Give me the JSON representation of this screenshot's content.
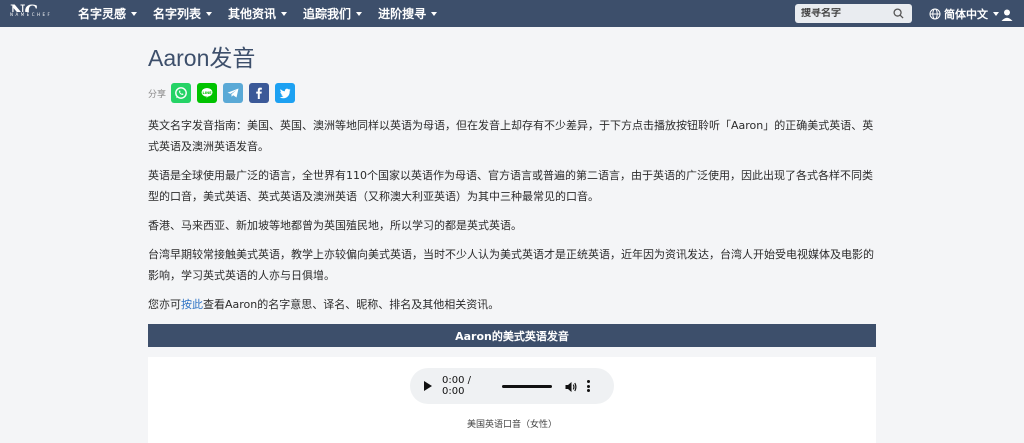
{
  "brand": {
    "logo_text": "NC",
    "logo_sub": "NAMECHEF"
  },
  "nav": {
    "items": [
      {
        "label": "名字灵感"
      },
      {
        "label": "名字列表"
      },
      {
        "label": "其他资讯"
      },
      {
        "label": "追踪我们"
      },
      {
        "label": "进阶搜寻"
      }
    ],
    "search_placeholder": "搜寻名字",
    "language": "简体中文"
  },
  "page": {
    "title": "Aaron发音",
    "share_label": "分享",
    "share_buttons": [
      {
        "name": "whatsapp",
        "color": "#25d366"
      },
      {
        "name": "line",
        "color": "#00c300"
      },
      {
        "name": "telegram",
        "color": "#5aa9d6"
      },
      {
        "name": "facebook",
        "color": "#3b5998"
      },
      {
        "name": "twitter",
        "color": "#1da1f2"
      }
    ],
    "paragraphs": [
      "英文名字发音指南：美国、英国、澳洲等地同样以英语为母语，但在发音上却存有不少差异，于下方点击播放按钮聆听「Aaron」的正确美式英语、英式英语及澳洲英语发音。",
      "英语是全球使用最广泛的语言，全世界有110个国家以英语作为母语、官方语言或普遍的第二语言，由于英语的广泛使用，因此出现了各式各样不同类型的口音，美式英语、英式英语及澳洲英语（又称澳大利亚英语）为其中三种最常见的口音。",
      "香港、马来西亚、新加坡等地都曾为英国殖民地，所以学习的都是英式英语。",
      "台湾早期较常接触美式英语，教学上亦较偏向美式英语，当时不少人认为美式英语才是正统英语，近年因为资讯发达，台湾人开始受电视媒体及电影的影响，学习英式英语的人亦与日俱增。"
    ],
    "last_para": {
      "prefix": "您亦可",
      "link": "按此",
      "suffix": "查看Aaron的名字意思、译名、昵称、排名及其他相关资讯。"
    },
    "section_title": "Aaron的美式英语发音",
    "audio": {
      "time": "0:00 / 0:00",
      "caption": "美国英语口音（女性）"
    }
  },
  "colors": {
    "nav_bg": "#3d4f6b",
    "link": "#2f73c4"
  }
}
